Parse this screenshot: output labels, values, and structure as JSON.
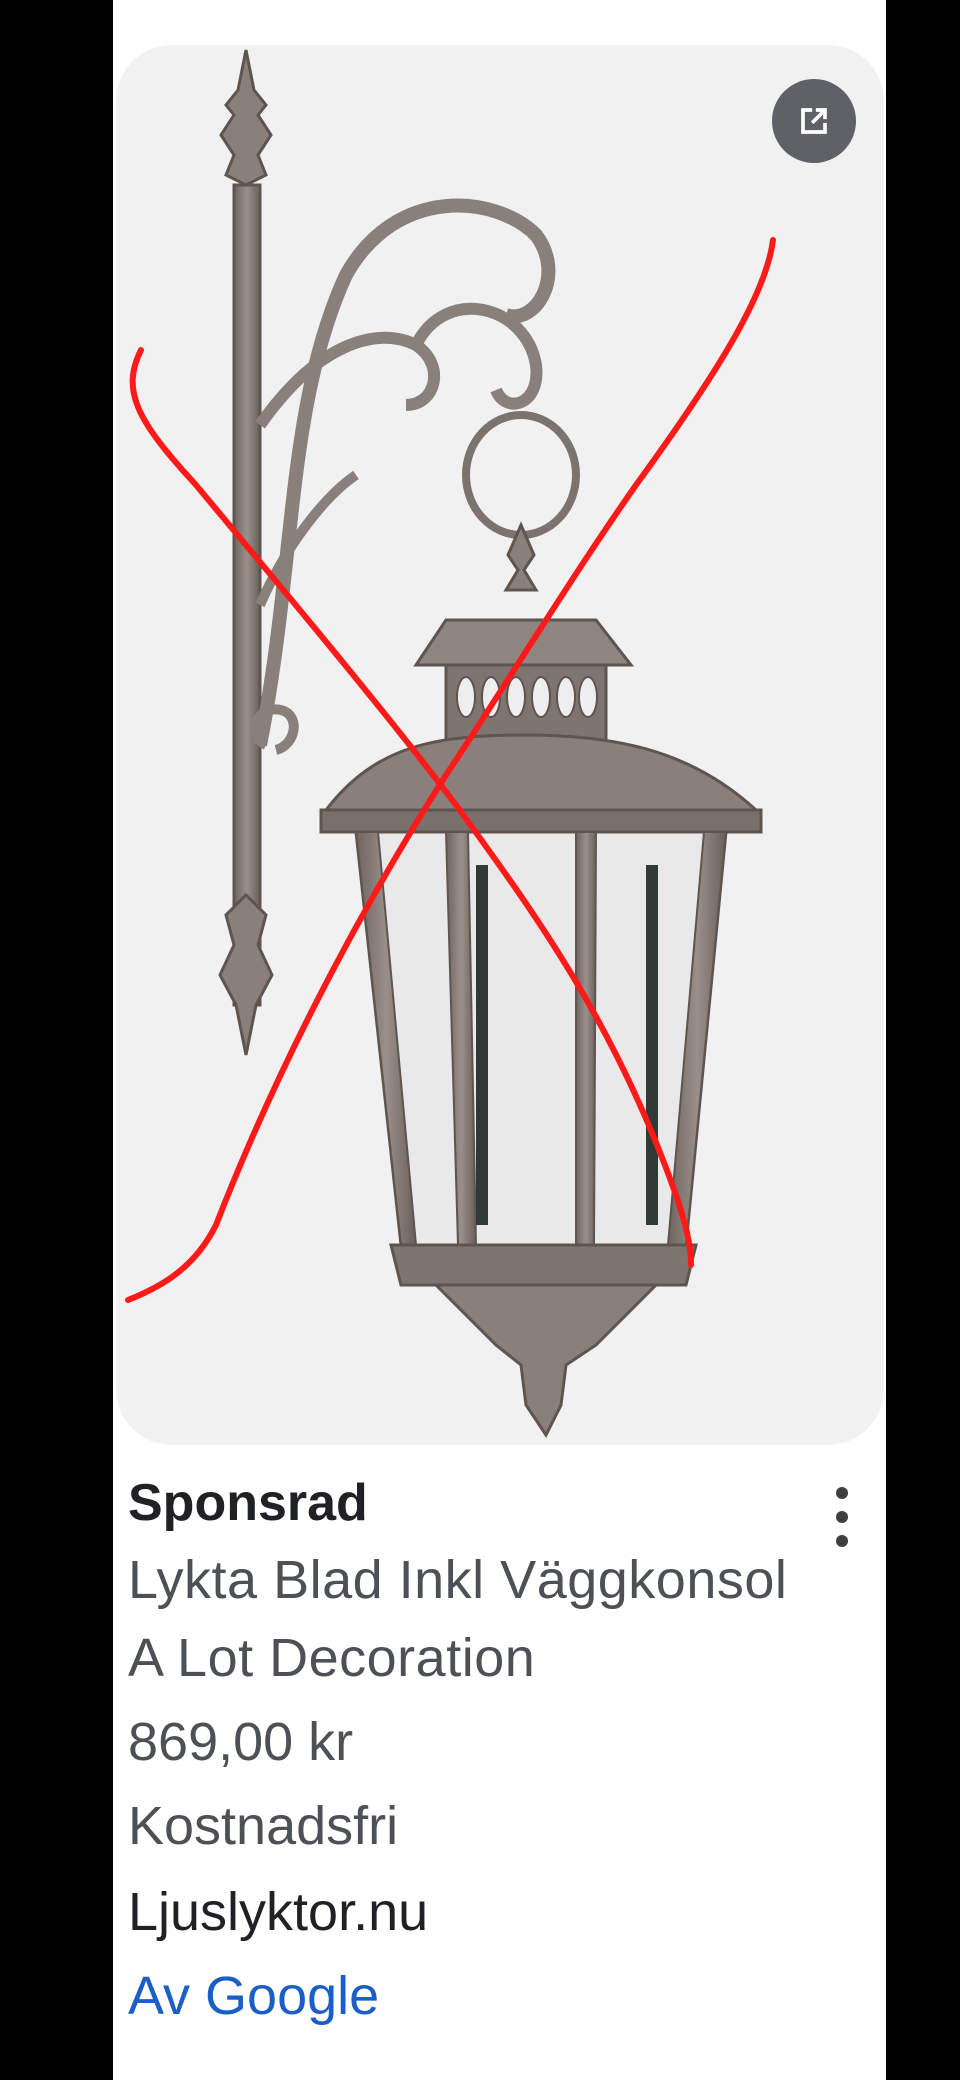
{
  "product": {
    "image_alt": "Lykta Blad Inkl Väggkonsol",
    "open_icon": "open-in-new-icon",
    "more_icon": "more-vert-icon",
    "sponsored_label": "Sponsrad",
    "title": "Lykta Blad Inkl Väggkonsol",
    "merchant": "A Lot Decoration",
    "price": "869,00 kr",
    "shipping": "Kostnadsfri",
    "store": "Ljuslyktor.nu",
    "by_google": "Av Google"
  },
  "colors": {
    "background": "#000000",
    "card": "#ffffff",
    "image_bg": "#f1f1f1",
    "text_dark": "#202124",
    "text_gray": "#4d5156",
    "link_blue": "#1a5fc9",
    "cross_red": "#ff1a1a"
  }
}
